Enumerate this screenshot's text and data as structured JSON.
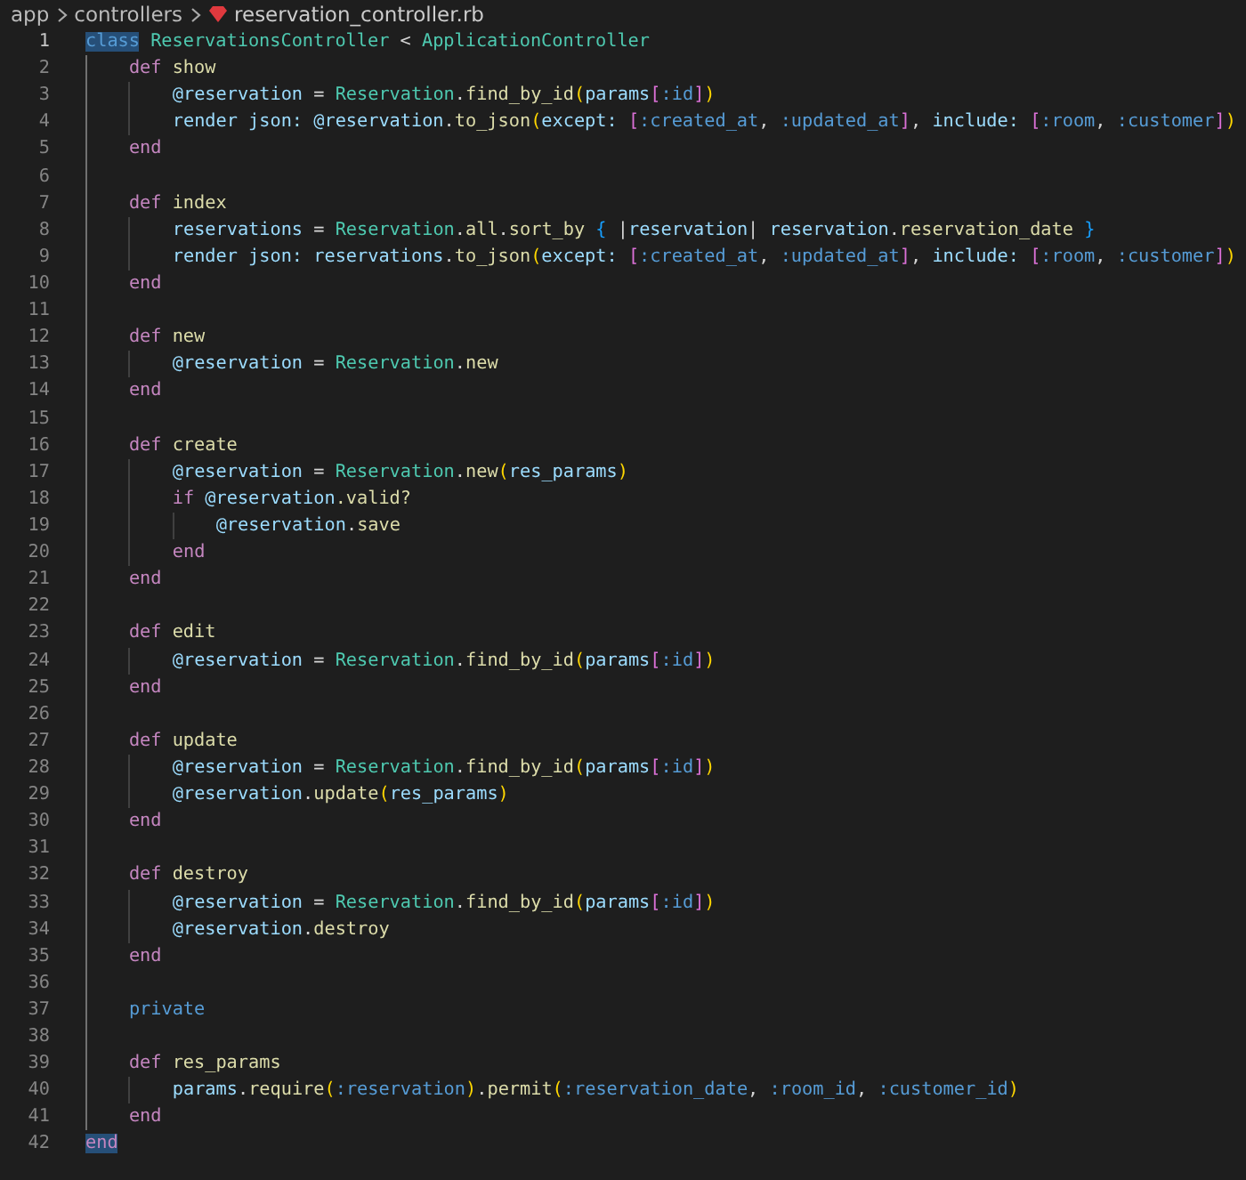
{
  "breadcrumb": [
    {
      "kind": "folder",
      "text": "app"
    },
    {
      "kind": "folder",
      "text": "controllers"
    },
    {
      "kind": "file",
      "text": "reservation_controller.rb"
    }
  ],
  "lines": [
    {
      "number": "1",
      "active": true,
      "tokens": [
        {
          "kind": "kw2",
          "text": "class",
          "highlighted": true
        },
        {
          "kind": "type",
          "text": " ReservationsController"
        },
        {
          "kind": "plain",
          "text": " < "
        },
        {
          "kind": "type",
          "text": "ApplicationController"
        }
      ],
      "children": [
        {
          "number": "2",
          "active": false,
          "tokens": [
            {
              "kind": "kw",
              "text": "def"
            },
            {
              "kind": "fn",
              "text": " show"
            }
          ],
          "children": [
            {
              "number": "3",
              "active": false,
              "tokens": [
                {
                  "kind": "var",
                  "text": "@reservation"
                },
                {
                  "kind": "plain",
                  "text": " = "
                },
                {
                  "kind": "type",
                  "text": "Reservation"
                },
                {
                  "kind": "plain",
                  "text": "."
                },
                {
                  "kind": "fn",
                  "text": "find_by_id"
                },
                {
                  "kind": "br1",
                  "text": "("
                },
                {
                  "kind": "var",
                  "text": "params"
                },
                {
                  "kind": "br2",
                  "text": "["
                },
                {
                  "kind": "sym",
                  "text": ":id"
                },
                {
                  "kind": "br2",
                  "text": "]"
                },
                {
                  "kind": "br1",
                  "text": ")"
                }
              ]
            },
            {
              "number": "4",
              "active": false,
              "tokens": [
                {
                  "kind": "var",
                  "text": "render"
                },
                {
                  "kind": "var",
                  "text": " json:"
                },
                {
                  "kind": "var",
                  "text": " @reservation"
                },
                {
                  "kind": "plain",
                  "text": "."
                },
                {
                  "kind": "fn",
                  "text": "to_json"
                },
                {
                  "kind": "br1",
                  "text": "("
                },
                {
                  "kind": "var",
                  "text": "except:"
                },
                {
                  "kind": "br2",
                  "text": " ["
                },
                {
                  "kind": "sym",
                  "text": ":created_at"
                },
                {
                  "kind": "plain",
                  "text": ", "
                },
                {
                  "kind": "sym",
                  "text": ":updated_at"
                },
                {
                  "kind": "br2",
                  "text": "]"
                },
                {
                  "kind": "plain",
                  "text": ", "
                },
                {
                  "kind": "var",
                  "text": "include:"
                },
                {
                  "kind": "br2",
                  "text": " ["
                },
                {
                  "kind": "sym",
                  "text": ":room"
                },
                {
                  "kind": "plain",
                  "text": ", "
                },
                {
                  "kind": "sym",
                  "text": ":customer"
                },
                {
                  "kind": "br2",
                  "text": "]"
                },
                {
                  "kind": "br1",
                  "text": ")"
                }
              ]
            }
          ]
        },
        {
          "number": "5",
          "active": false,
          "tokens": [
            {
              "kind": "kw",
              "text": "end"
            }
          ]
        },
        {
          "number": "6",
          "active": false
        },
        {
          "number": "7",
          "active": false,
          "tokens": [
            {
              "kind": "kw",
              "text": "def"
            },
            {
              "kind": "fn",
              "text": " index"
            }
          ],
          "children": [
            {
              "number": "8",
              "active": false,
              "tokens": [
                {
                  "kind": "var",
                  "text": "reservations"
                },
                {
                  "kind": "plain",
                  "text": " = "
                },
                {
                  "kind": "type",
                  "text": "Reservation"
                },
                {
                  "kind": "plain",
                  "text": "."
                },
                {
                  "kind": "fn",
                  "text": "all"
                },
                {
                  "kind": "plain",
                  "text": "."
                },
                {
                  "kind": "fn",
                  "text": "sort_by"
                },
                {
                  "kind": "br3",
                  "text": " {"
                },
                {
                  "kind": "plain",
                  "text": " |"
                },
                {
                  "kind": "var",
                  "text": "reservation"
                },
                {
                  "kind": "plain",
                  "text": "| "
                },
                {
                  "kind": "var",
                  "text": "reservation"
                },
                {
                  "kind": "plain",
                  "text": "."
                },
                {
                  "kind": "fn",
                  "text": "reservation_date"
                },
                {
                  "kind": "br3",
                  "text": " }"
                }
              ]
            },
            {
              "number": "9",
              "active": false,
              "tokens": [
                {
                  "kind": "var",
                  "text": "render"
                },
                {
                  "kind": "var",
                  "text": " json:"
                },
                {
                  "kind": "var",
                  "text": " reservations"
                },
                {
                  "kind": "plain",
                  "text": "."
                },
                {
                  "kind": "fn",
                  "text": "to_json"
                },
                {
                  "kind": "br1",
                  "text": "("
                },
                {
                  "kind": "var",
                  "text": "except:"
                },
                {
                  "kind": "br2",
                  "text": " ["
                },
                {
                  "kind": "sym",
                  "text": ":created_at"
                },
                {
                  "kind": "plain",
                  "text": ", "
                },
                {
                  "kind": "sym",
                  "text": ":updated_at"
                },
                {
                  "kind": "br2",
                  "text": "]"
                },
                {
                  "kind": "plain",
                  "text": ", "
                },
                {
                  "kind": "var",
                  "text": "include:"
                },
                {
                  "kind": "br2",
                  "text": " ["
                },
                {
                  "kind": "sym",
                  "text": ":room"
                },
                {
                  "kind": "plain",
                  "text": ", "
                },
                {
                  "kind": "sym",
                  "text": ":customer"
                },
                {
                  "kind": "br2",
                  "text": "]"
                },
                {
                  "kind": "br1",
                  "text": ")"
                }
              ]
            }
          ]
        },
        {
          "number": "10",
          "active": false,
          "tokens": [
            {
              "kind": "kw",
              "text": "end"
            }
          ]
        },
        {
          "number": "11",
          "active": false
        },
        {
          "number": "12",
          "active": false,
          "tokens": [
            {
              "kind": "kw",
              "text": "def"
            },
            {
              "kind": "fn",
              "text": " new"
            }
          ],
          "children": [
            {
              "number": "13",
              "active": false,
              "tokens": [
                {
                  "kind": "var",
                  "text": "@reservation"
                },
                {
                  "kind": "plain",
                  "text": " = "
                },
                {
                  "kind": "type",
                  "text": "Reservation"
                },
                {
                  "kind": "plain",
                  "text": "."
                },
                {
                  "kind": "fn",
                  "text": "new"
                }
              ]
            }
          ]
        },
        {
          "number": "14",
          "active": false,
          "tokens": [
            {
              "kind": "kw",
              "text": "end"
            }
          ]
        },
        {
          "number": "15",
          "active": false
        },
        {
          "number": "16",
          "active": false,
          "tokens": [
            {
              "kind": "kw",
              "text": "def"
            },
            {
              "kind": "fn",
              "text": " create"
            }
          ],
          "children": [
            {
              "number": "17",
              "active": false,
              "tokens": [
                {
                  "kind": "var",
                  "text": "@reservation"
                },
                {
                  "kind": "plain",
                  "text": " = "
                },
                {
                  "kind": "type",
                  "text": "Reservation"
                },
                {
                  "kind": "plain",
                  "text": "."
                },
                {
                  "kind": "fn",
                  "text": "new"
                },
                {
                  "kind": "br1",
                  "text": "("
                },
                {
                  "kind": "var",
                  "text": "res_params"
                },
                {
                  "kind": "br1",
                  "text": ")"
                }
              ]
            },
            {
              "number": "18",
              "active": false,
              "tokens": [
                {
                  "kind": "kw",
                  "text": "if"
                },
                {
                  "kind": "var",
                  "text": " @reservation"
                },
                {
                  "kind": "fn",
                  "text": ".valid?"
                }
              ],
              "children": [
                {
                  "number": "19",
                  "active": false,
                  "tokens": [
                    {
                      "kind": "var",
                      "text": "@reservation"
                    },
                    {
                      "kind": "plain",
                      "text": "."
                    },
                    {
                      "kind": "fn",
                      "text": "save"
                    }
                  ]
                }
              ]
            },
            {
              "number": "20",
              "active": false,
              "tokens": [
                {
                  "kind": "kw",
                  "text": "end"
                }
              ]
            }
          ]
        },
        {
          "number": "21",
          "active": false,
          "tokens": [
            {
              "kind": "kw",
              "text": "end"
            }
          ]
        },
        {
          "number": "22",
          "active": false
        },
        {
          "number": "23",
          "active": false,
          "tokens": [
            {
              "kind": "kw",
              "text": "def"
            },
            {
              "kind": "fn",
              "text": " edit"
            }
          ],
          "children": [
            {
              "number": "24",
              "active": false,
              "tokens": [
                {
                  "kind": "var",
                  "text": "@reservation"
                },
                {
                  "kind": "plain",
                  "text": " = "
                },
                {
                  "kind": "type",
                  "text": "Reservation"
                },
                {
                  "kind": "plain",
                  "text": "."
                },
                {
                  "kind": "fn",
                  "text": "find_by_id"
                },
                {
                  "kind": "br1",
                  "text": "("
                },
                {
                  "kind": "var",
                  "text": "params"
                },
                {
                  "kind": "br2",
                  "text": "["
                },
                {
                  "kind": "sym",
                  "text": ":id"
                },
                {
                  "kind": "br2",
                  "text": "]"
                },
                {
                  "kind": "br1",
                  "text": ")"
                }
              ]
            }
          ]
        },
        {
          "number": "25",
          "active": false,
          "tokens": [
            {
              "kind": "kw",
              "text": "end"
            }
          ]
        },
        {
          "number": "26",
          "active": false
        },
        {
          "number": "27",
          "active": false,
          "tokens": [
            {
              "kind": "kw",
              "text": "def"
            },
            {
              "kind": "fn",
              "text": " update"
            }
          ],
          "children": [
            {
              "number": "28",
              "active": false,
              "tokens": [
                {
                  "kind": "var",
                  "text": "@reservation"
                },
                {
                  "kind": "plain",
                  "text": " = "
                },
                {
                  "kind": "type",
                  "text": "Reservation"
                },
                {
                  "kind": "plain",
                  "text": "."
                },
                {
                  "kind": "fn",
                  "text": "find_by_id"
                },
                {
                  "kind": "br1",
                  "text": "("
                },
                {
                  "kind": "var",
                  "text": "params"
                },
                {
                  "kind": "br2",
                  "text": "["
                },
                {
                  "kind": "sym",
                  "text": ":id"
                },
                {
                  "kind": "br2",
                  "text": "]"
                },
                {
                  "kind": "br1",
                  "text": ")"
                }
              ]
            },
            {
              "number": "29",
              "active": false,
              "tokens": [
                {
                  "kind": "var",
                  "text": "@reservation"
                },
                {
                  "kind": "plain",
                  "text": "."
                },
                {
                  "kind": "fn",
                  "text": "update"
                },
                {
                  "kind": "br1",
                  "text": "("
                },
                {
                  "kind": "var",
                  "text": "res_params"
                },
                {
                  "kind": "br1",
                  "text": ")"
                }
              ]
            }
          ]
        },
        {
          "number": "30",
          "active": false,
          "tokens": [
            {
              "kind": "kw",
              "text": "end"
            }
          ]
        },
        {
          "number": "31",
          "active": false
        },
        {
          "number": "32",
          "active": false,
          "tokens": [
            {
              "kind": "kw",
              "text": "def"
            },
            {
              "kind": "fn",
              "text": " destroy"
            }
          ],
          "children": [
            {
              "number": "33",
              "active": false,
              "tokens": [
                {
                  "kind": "var",
                  "text": "@reservation"
                },
                {
                  "kind": "plain",
                  "text": " = "
                },
                {
                  "kind": "type",
                  "text": "Reservation"
                },
                {
                  "kind": "plain",
                  "text": "."
                },
                {
                  "kind": "fn",
                  "text": "find_by_id"
                },
                {
                  "kind": "br1",
                  "text": "("
                },
                {
                  "kind": "var",
                  "text": "params"
                },
                {
                  "kind": "br2",
                  "text": "["
                },
                {
                  "kind": "sym",
                  "text": ":id"
                },
                {
                  "kind": "br2",
                  "text": "]"
                },
                {
                  "kind": "br1",
                  "text": ")"
                }
              ]
            },
            {
              "number": "34",
              "active": false,
              "tokens": [
                {
                  "kind": "var",
                  "text": "@reservation"
                },
                {
                  "kind": "plain",
                  "text": "."
                },
                {
                  "kind": "fn",
                  "text": "destroy"
                }
              ]
            }
          ]
        },
        {
          "number": "35",
          "active": false,
          "tokens": [
            {
              "kind": "kw",
              "text": "end"
            }
          ]
        },
        {
          "number": "36",
          "active": false
        },
        {
          "number": "37",
          "active": false,
          "tokens": [
            {
              "kind": "kw2",
              "text": "private"
            }
          ]
        },
        {
          "number": "38",
          "active": false
        },
        {
          "number": "39",
          "active": false,
          "tokens": [
            {
              "kind": "kw",
              "text": "def"
            },
            {
              "kind": "fn",
              "text": " res_params"
            }
          ],
          "children": [
            {
              "number": "40",
              "active": false,
              "tokens": [
                {
                  "kind": "var",
                  "text": "params"
                },
                {
                  "kind": "plain",
                  "text": "."
                },
                {
                  "kind": "fn",
                  "text": "require"
                },
                {
                  "kind": "br1",
                  "text": "("
                },
                {
                  "kind": "sym",
                  "text": ":reservation"
                },
                {
                  "kind": "br1",
                  "text": ")"
                },
                {
                  "kind": "plain",
                  "text": "."
                },
                {
                  "kind": "fn",
                  "text": "permit"
                },
                {
                  "kind": "br1",
                  "text": "("
                },
                {
                  "kind": "sym",
                  "text": ":reservation_date"
                },
                {
                  "kind": "plain",
                  "text": ", "
                },
                {
                  "kind": "sym",
                  "text": ":room_id"
                },
                {
                  "kind": "plain",
                  "text": ", "
                },
                {
                  "kind": "sym",
                  "text": ":customer_id"
                },
                {
                  "kind": "br1",
                  "text": ")"
                }
              ]
            }
          ]
        },
        {
          "number": "41",
          "active": false,
          "tokens": [
            {
              "kind": "kw",
              "text": "end"
            }
          ]
        }
      ]
    },
    {
      "number": "42",
      "active": false,
      "tokens": [
        {
          "kind": "kw",
          "text": "end",
          "highlighted": true
        }
      ]
    }
  ]
}
